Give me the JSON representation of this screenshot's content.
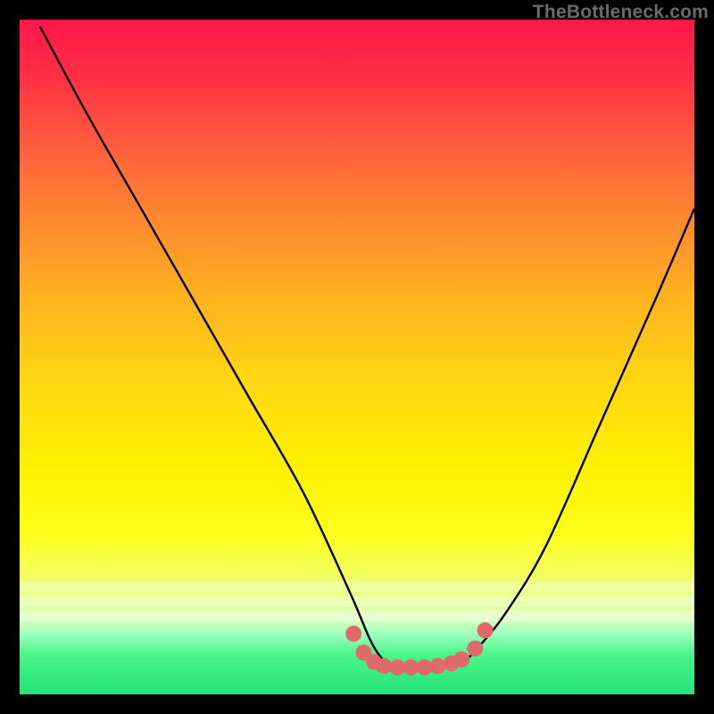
{
  "watermark": "TheBottleneck.com",
  "chart_data": {
    "type": "line",
    "title": "",
    "xlabel": "",
    "ylabel": "",
    "xlim": [
      0,
      100
    ],
    "ylim": [
      0,
      100
    ],
    "series": [
      {
        "name": "curve",
        "x": [
          3,
          10,
          18,
          26,
          34,
          42,
          49,
          52,
          54,
          56,
          58,
          60,
          62,
          64,
          66,
          68,
          72,
          78,
          86,
          94,
          100
        ],
        "y": [
          99,
          86,
          72,
          58,
          44,
          30,
          15,
          8,
          5,
          4,
          4,
          4,
          4,
          4,
          5,
          7,
          12,
          22,
          40,
          58,
          72
        ]
      }
    ],
    "markers": [
      {
        "x": 49.5,
        "y": 9.0
      },
      {
        "x": 51.0,
        "y": 6.2
      },
      {
        "x": 52.5,
        "y": 4.8
      },
      {
        "x": 54.0,
        "y": 4.2
      },
      {
        "x": 56.0,
        "y": 4.0
      },
      {
        "x": 58.0,
        "y": 4.0
      },
      {
        "x": 60.0,
        "y": 4.0
      },
      {
        "x": 62.0,
        "y": 4.2
      },
      {
        "x": 64.0,
        "y": 4.6
      },
      {
        "x": 65.5,
        "y": 5.2
      },
      {
        "x": 67.5,
        "y": 6.8
      },
      {
        "x": 69.0,
        "y": 9.5
      }
    ],
    "marker_color": "#e06a6a",
    "curve_color": "#000000",
    "white_bands_y": [
      84.0,
      86.2,
      88.4
    ]
  }
}
